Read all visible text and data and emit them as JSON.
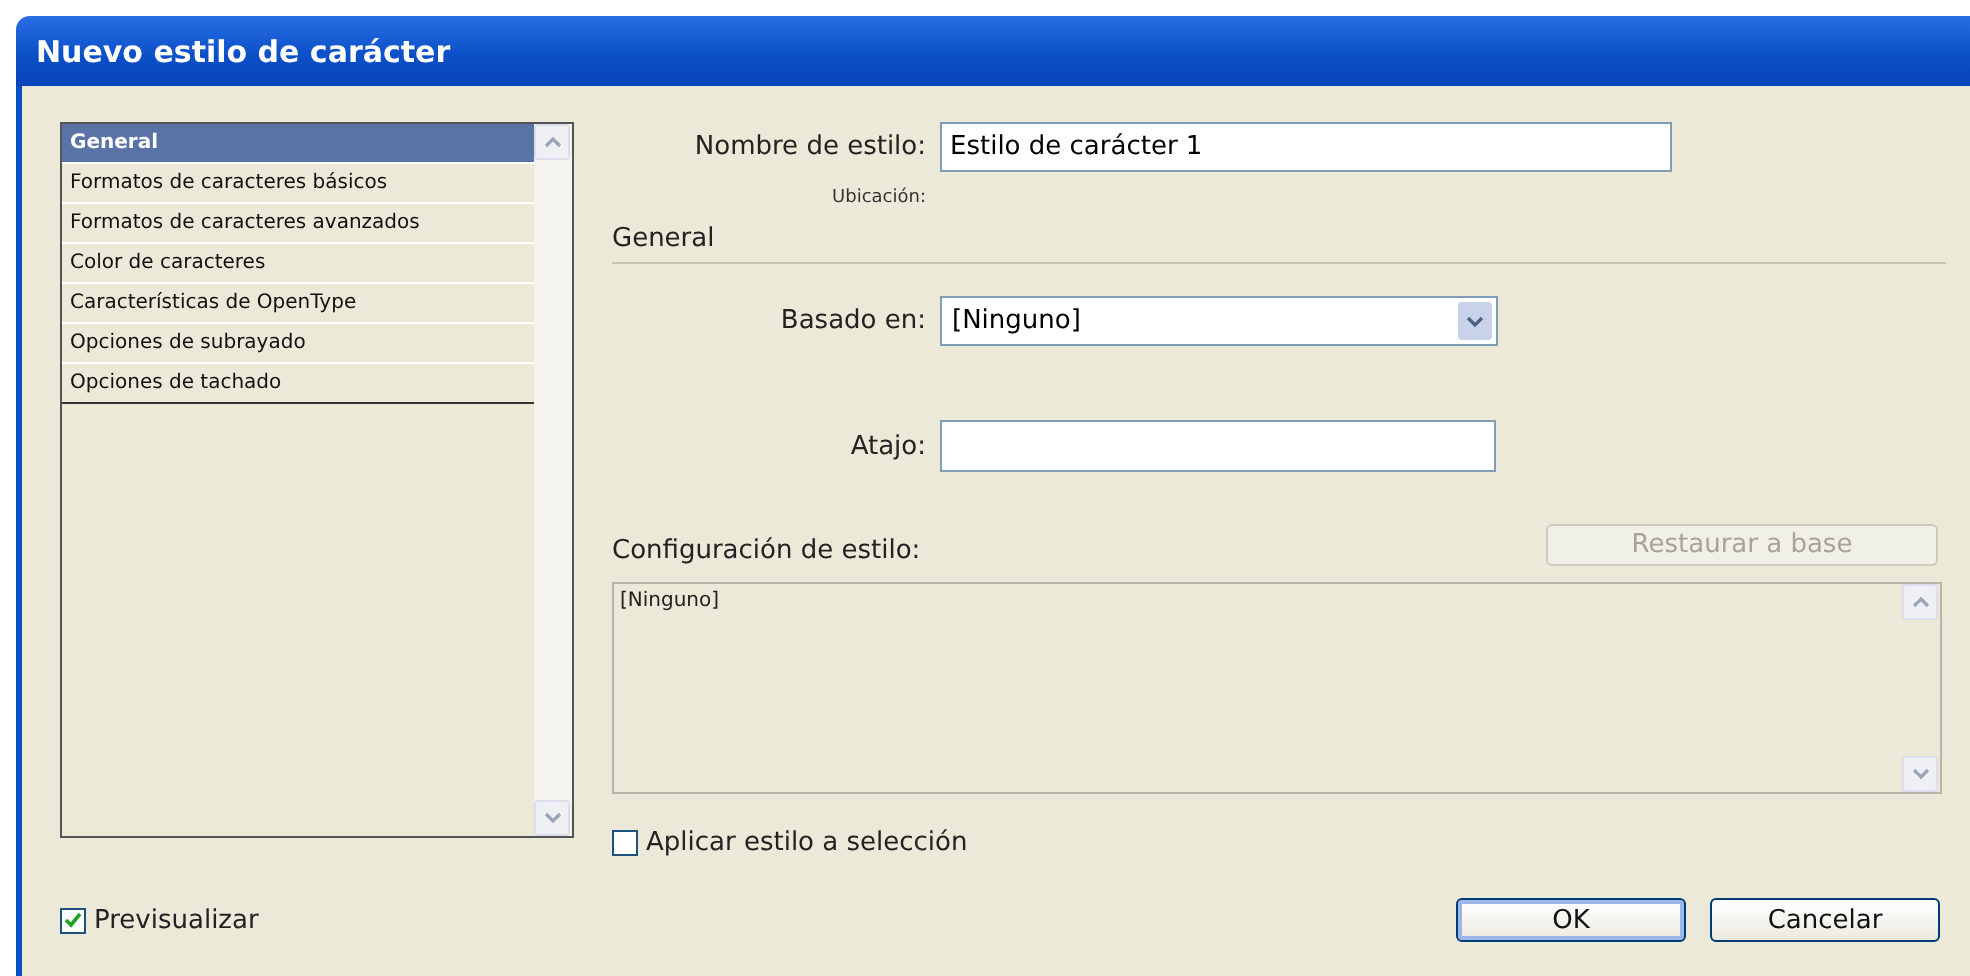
{
  "window": {
    "title": "Nuevo estilo de carácter"
  },
  "sidebar": {
    "items": [
      {
        "label": "General",
        "selected": true
      },
      {
        "label": "Formatos de caracteres básicos",
        "selected": false
      },
      {
        "label": "Formatos de caracteres avanzados",
        "selected": false
      },
      {
        "label": "Color de caracteres",
        "selected": false
      },
      {
        "label": "Características de OpenType",
        "selected": false
      },
      {
        "label": "Opciones de subrayado",
        "selected": false
      },
      {
        "label": "Opciones de tachado",
        "selected": false
      }
    ]
  },
  "style_name": {
    "label": "Nombre de estilo:",
    "value": "Estilo de carácter 1"
  },
  "location": {
    "label": "Ubicación:"
  },
  "section": {
    "title": "General"
  },
  "based_on": {
    "label": "Basado en:",
    "value": "[Ninguno]"
  },
  "shortcut": {
    "label": "Atajo:"
  },
  "style_settings": {
    "label": "Configuración de estilo:",
    "reset_button": {
      "label": "Restaurar a base",
      "disabled": true
    },
    "content": "[Ninguno]"
  },
  "apply_to_selection": {
    "label": "Aplicar estilo a selección",
    "checked": false
  },
  "preview": {
    "label": "Previsualizar",
    "checked": true
  },
  "buttons": [
    {
      "label": "OK",
      "default": true
    },
    {
      "label": "Cancelar",
      "default": false
    }
  ]
}
